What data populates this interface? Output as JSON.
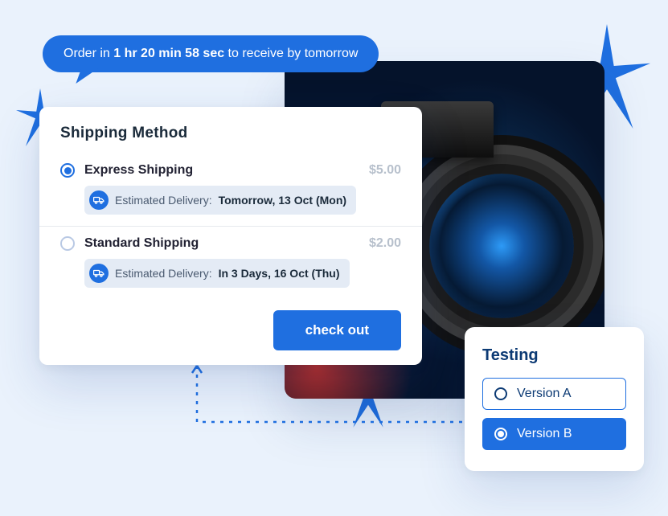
{
  "banner": {
    "prefix": "Order in ",
    "countdown": "1 hr 20 min 58 sec",
    "suffix": " to receive by tomorrow"
  },
  "shipping": {
    "title": "Shipping Method",
    "options": [
      {
        "label": "Express Shipping",
        "price": "$5.00",
        "selected": true,
        "est_label": "Estimated Delivery: ",
        "est_date": "Tomorrow, 13 Oct (Mon)"
      },
      {
        "label": "Standard Shipping",
        "price": "$2.00",
        "selected": false,
        "est_label": "Estimated Delivery: ",
        "est_date": "In 3 Days, 16 Oct (Thu)"
      }
    ],
    "checkout_label": "check out"
  },
  "testing": {
    "title": "Testing",
    "versions": [
      {
        "label": "Version A",
        "selected": false
      },
      {
        "label": "Version B",
        "selected": true
      }
    ]
  },
  "colors": {
    "primary": "#1f6fe0",
    "bg": "#eaf2fc"
  }
}
